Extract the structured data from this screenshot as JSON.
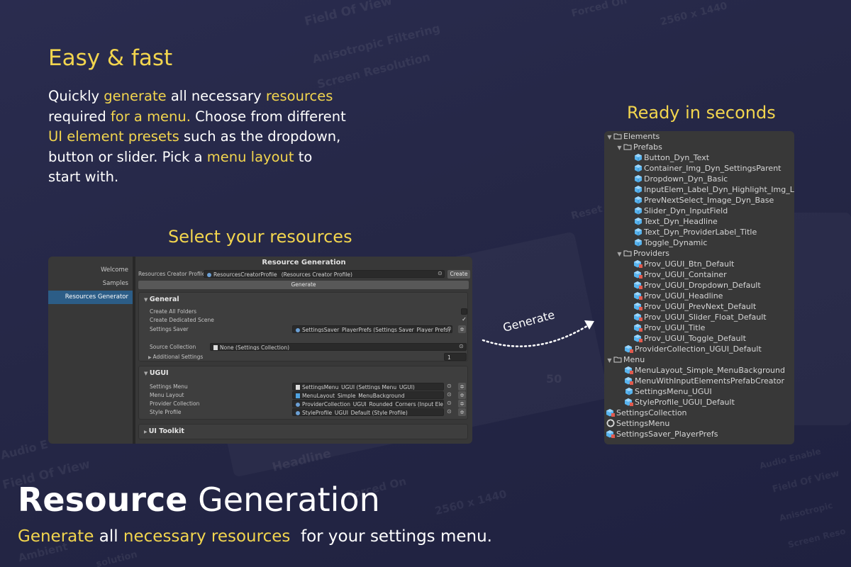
{
  "colors": {
    "background": "#262848",
    "highlight": "#f2d54e",
    "text": "#ffffff",
    "editor_bg": "#383838",
    "selection": "#2c5d87"
  },
  "background_text": [
    "Field Of View",
    "Anisotropic Filtering",
    "Screen Resolution",
    "Forced On",
    "2560 x 1440",
    "Reset",
    "50",
    "Audio E",
    "Field Of View",
    "Headline",
    "Forced On",
    "2560 x 1440",
    "Audio Enable",
    "Field Of View",
    "Anisotropic",
    "Screen Reso",
    "Ambient",
    "solution"
  ],
  "intro": {
    "title": "Easy & fast",
    "p1": "Quickly ",
    "p2": "generate",
    "p3": " all necessary ",
    "p4": "resources",
    "p5": " required ",
    "p6": "for a menu.",
    "p7": " Choose from different ",
    "p8": "UI element presets",
    "p9": " such as the dropdown, button or slider. Pick a ",
    "p10": "menu layout",
    "p11": " to start with."
  },
  "select_heading": "Select your resources",
  "ready_heading": "Ready in seconds",
  "editor": {
    "title": "Resource Generation",
    "sidebar": [
      "Welcome",
      "Samples",
      "Resources Generator"
    ],
    "selected_sidebar": "Resources Generator",
    "profile_label": "Resources Creator Profile",
    "profile_value": "ResourcesCreatorProfile_ (Resources Creator Profile)",
    "create_button": "Create",
    "generate_button": "Generate",
    "general": {
      "title": "General",
      "create_all_folders": "Create All Folders",
      "create_dedicated_scene": "Create Dedicated Scene",
      "settings_saver_label": "Settings Saver",
      "settings_saver_value": "SettingsSaver_PlayerPrefs (Settings Saver_Player Prefs)",
      "source_collection_label": "Source Collection",
      "source_collection_value": "None (Settings Collection)",
      "additional_settings": "Additional Settings",
      "additional_settings_value": "1"
    },
    "ugui": {
      "title": "UGUI",
      "settings_menu_label": "Settings Menu",
      "settings_menu_value": "SettingsMenu_UGUI (Settings Menu_UGUI)",
      "menu_layout_label": "Menu Layout",
      "menu_layout_value": "MenuLayout_Simple_MenuBackground",
      "provider_collection_label": "Provider Collection",
      "provider_collection_value": "ProviderCollection_UGUI_Rounded_Corners (Input Element",
      "style_profile_label": "Style Profile",
      "style_profile_value": "StyleProfile_UGUI_Default (Style Profile)"
    },
    "ui_toolkit": {
      "title": "UI Toolkit"
    }
  },
  "arrow_label": "Generate",
  "tree": {
    "elements": "Elements",
    "prefabs": "Prefabs",
    "prefab_items": [
      "Button_Dyn_Text",
      "Container_Img_Dyn_SettingsParent",
      "Dropdown_Dyn_Basic",
      "InputElem_Label_Dyn_Highlight_Img_L",
      "PrevNextSelect_Image_Dyn_Base",
      "Slider_Dyn_InputField",
      "Text_Dyn_Headline",
      "Text_Dyn_ProviderLabel_Title",
      "Toggle_Dynamic"
    ],
    "providers": "Providers",
    "provider_items": [
      "Prov_UGUI_Btn_Default",
      "Prov_UGUI_Container",
      "Prov_UGUI_Dropdown_Default",
      "Prov_UGUI_Headline",
      "Prov_UGUI_PrevNext_Default",
      "Prov_UGUI_Slider_Float_Default",
      "Prov_UGUI_Title",
      "Prov_UGUI_Toggle_Default"
    ],
    "provider_collection": "ProviderCollection_UGUI_Default",
    "menu": "Menu",
    "menu_items": [
      "MenuLayout_Simple_MenuBackground",
      "MenuWithInputElementsPrefabCreator",
      "SettingsMenu_UGUI",
      "StyleProfile_UGUI_Default"
    ],
    "root_items": [
      "SettingsCollection",
      "SettingsMenu",
      "SettingsSaver_PlayerPrefs"
    ]
  },
  "footer": {
    "title_bold": "Resource",
    "title_rest": " Generation",
    "s1": "Generate",
    "s2": " all ",
    "s3": "necessary resources",
    "s4": "  for your settings menu."
  }
}
